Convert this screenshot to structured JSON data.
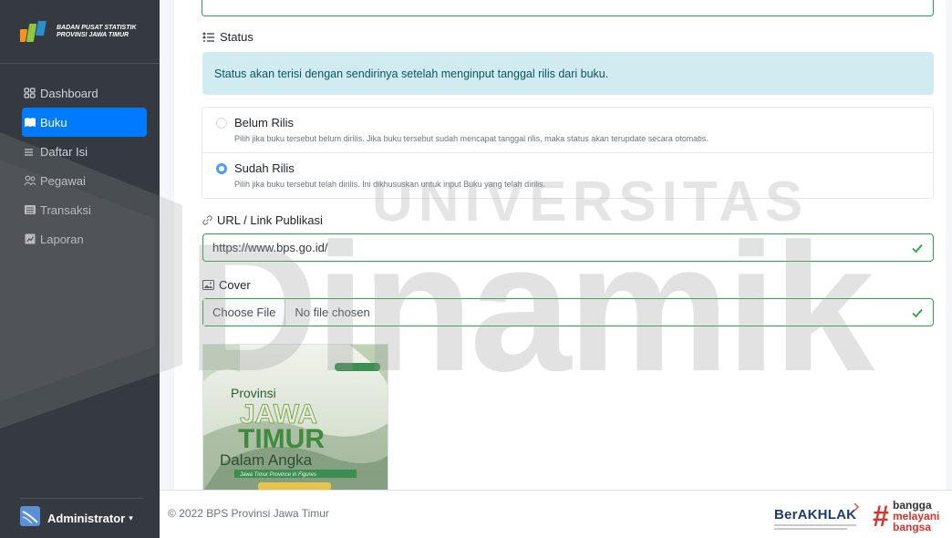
{
  "sidebar": {
    "brand": {
      "line1": "BADAN PUSAT STATISTIK",
      "line2": "PROVINSI JAWA TIMUR"
    },
    "items": [
      {
        "label": "Dashboard",
        "icon": "dashboard-icon"
      },
      {
        "label": "Buku",
        "icon": "book-icon",
        "active": true
      },
      {
        "label": "Daftar Isi",
        "icon": "list-icon"
      },
      {
        "label": "Pegawai",
        "icon": "users-icon"
      },
      {
        "label": "Transaksi",
        "icon": "transaction-icon"
      },
      {
        "label": "Laporan",
        "icon": "report-icon"
      }
    ],
    "user": {
      "name": "Administrator"
    }
  },
  "form": {
    "status_label": "Status",
    "status_alert": "Status akan terisi dengan sendirinya setelah menginput tanggal rilis dari buku.",
    "options": [
      {
        "title": "Belum Rilis",
        "desc": "Pilih jika buku tersebut belum dirilis. Jika buku tersebut sudah mencapat tanggal rilis, maka status akan terupdate secara otomatis.",
        "checked": false
      },
      {
        "title": "Sudah Rilis",
        "desc": "Pilih jika buku tersebut telah dirilis. Ini dikhususkan untuk input Buku yang telah dirilis.",
        "checked": true
      }
    ],
    "url_label": "URL / Link Publikasi",
    "url_value": "https://www.bps.go.id/",
    "cover_label": "Cover",
    "file_button": "Choose File",
    "file_name": "No file chosen",
    "cover_image": {
      "line1": "Provinsi",
      "line2": "JAWA",
      "line3": "TIMUR",
      "line4": "Dalam Angka",
      "line5": "Jawa Timur Province in Figures"
    }
  },
  "footer": {
    "copyright": "© 2022 BPS Provinsi Jawa Timur",
    "logo1": "BerAKHLAK",
    "logo2_l1": "bangga",
    "logo2_l2": "melayani",
    "logo2_l3": "bangsa"
  },
  "watermark": {
    "top": "UNIVERSITAS",
    "bottom": "Dinamik"
  },
  "colors": {
    "sidebar": "#343a40",
    "active": "#007bff",
    "success": "#28a745",
    "alert_bg": "#d1ecf1",
    "alert_text": "#0c5460"
  }
}
